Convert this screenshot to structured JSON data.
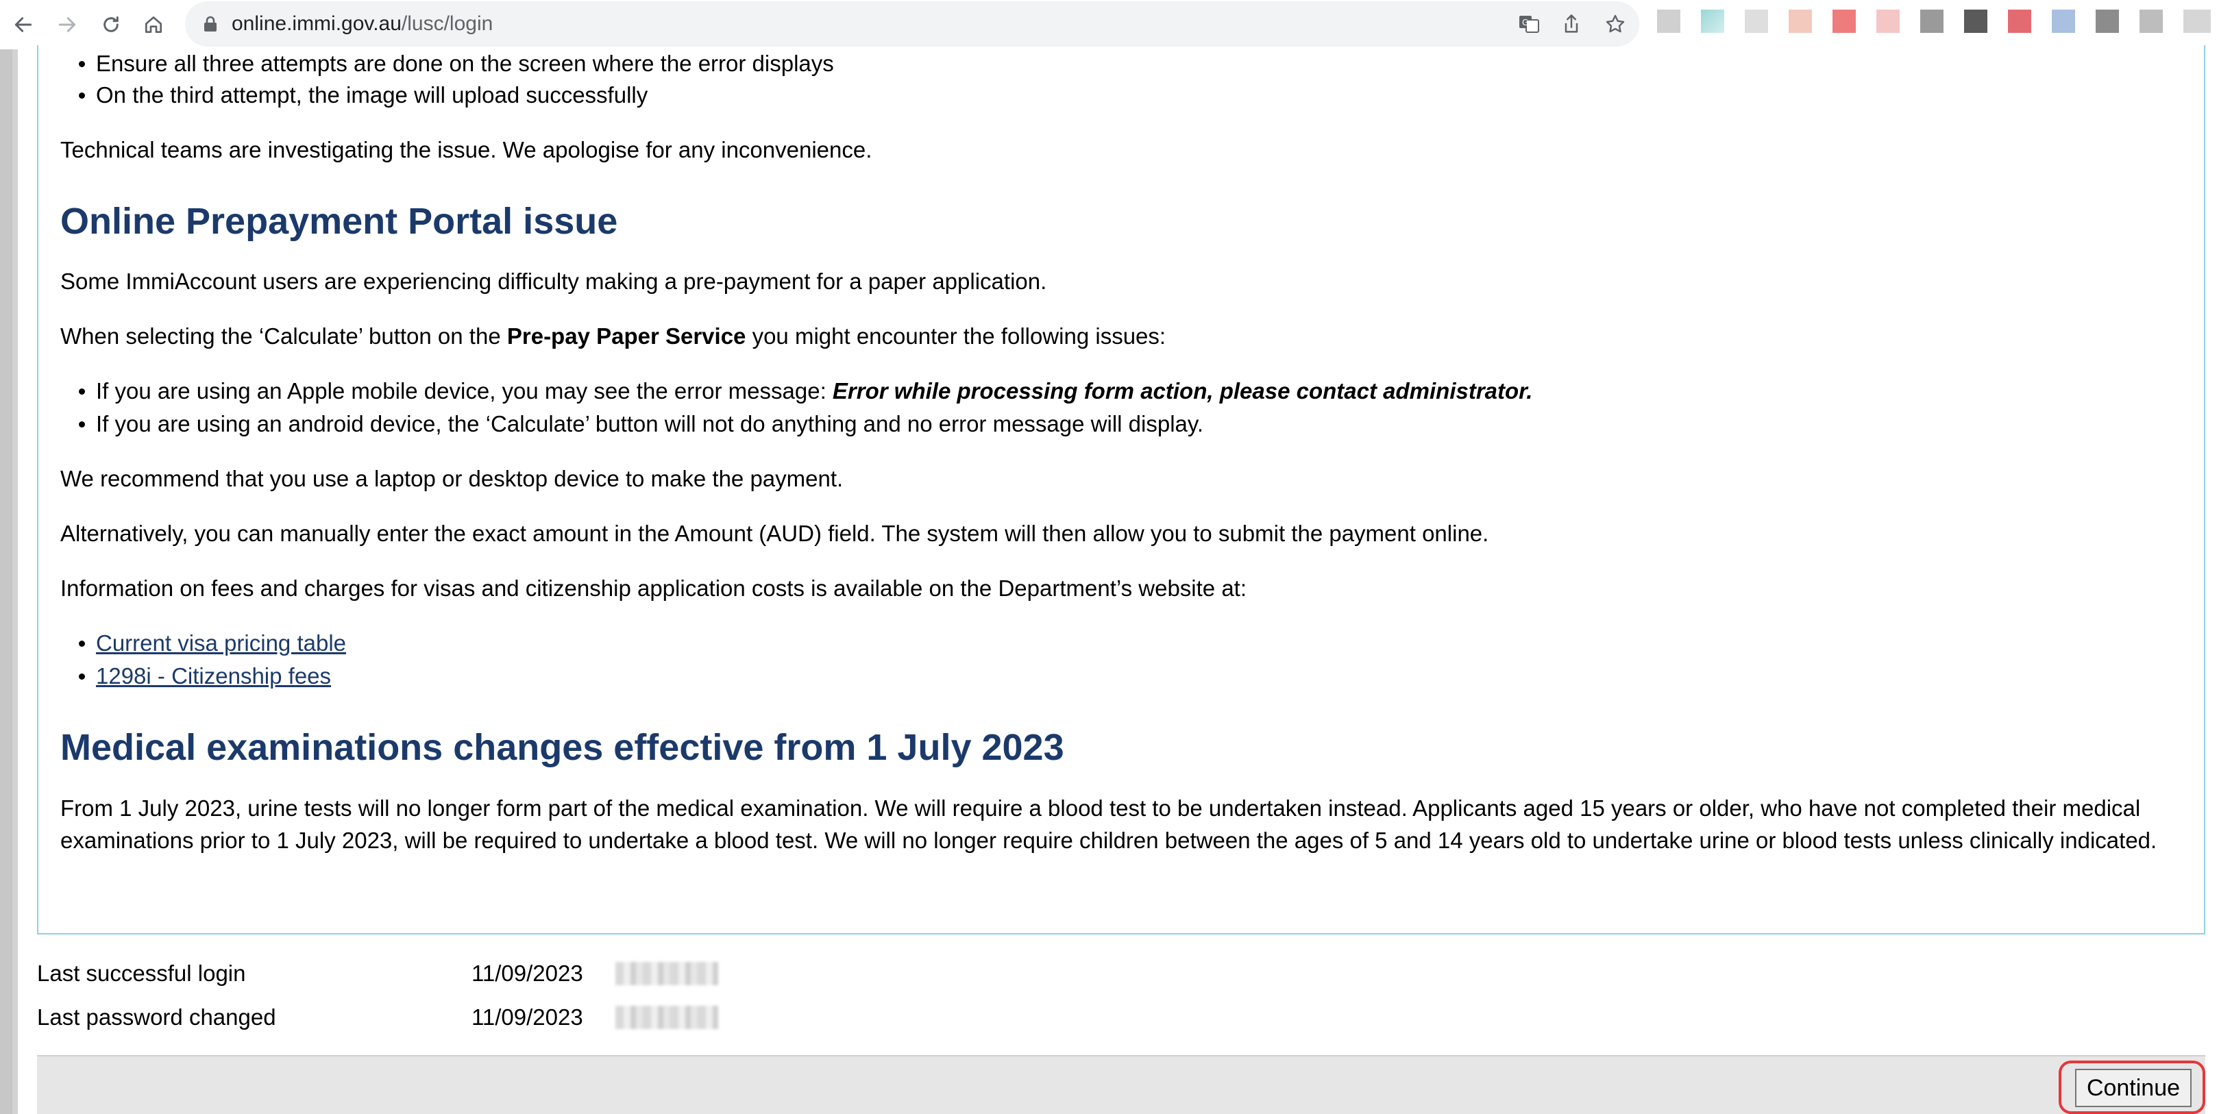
{
  "browser": {
    "url_host": "online.immi.gov.au",
    "url_path": "/lusc/login",
    "icons": [
      "back-arrow-icon",
      "forward-arrow-icon",
      "reload-icon",
      "home-icon",
      "lock-icon",
      "translate-icon",
      "share-icon",
      "star-icon"
    ]
  },
  "notice": {
    "intro_bullets": [
      "Ensure all three attempts are done on the screen where the error displays",
      "On the third attempt, the image will upload successfully"
    ],
    "intro_note": "Technical teams are investigating the issue. We apologise for any inconvenience.",
    "prepay": {
      "heading": "Online Prepayment Portal issue",
      "p1": "Some ImmiAccount users are experiencing difficulty making a pre-payment for a paper application.",
      "p2_before": "When selecting the ‘Calculate’ button on the ",
      "p2_bold": "Pre-pay Paper Service",
      "p2_after": " you might encounter the following issues:",
      "bullet1_before": "If you are using an Apple mobile device, you may see the error message: ",
      "bullet1_emph": "Error while processing form action, please contact administrator.",
      "bullet2": "If you are using an android device, the ‘Calculate’ button will not do anything and no error message will display.",
      "p3": "We recommend that you use a laptop or desktop device to make the payment.",
      "p4": "Alternatively, you can manually enter the exact amount in the Amount (AUD) field. The system will then allow you to submit the payment online.",
      "p5": "Information on fees and charges for visas and citizenship application costs is available on the Department’s website at:",
      "links": [
        "Current visa pricing table",
        "1298i - Citizenship fees"
      ]
    },
    "medical": {
      "heading": "Medical examinations changes effective from 1 July 2023",
      "body": "From 1 July 2023, urine tests will no longer form part of the medical examination. We will require a blood test to be undertaken instead. Applicants aged 15 years or older, who have not completed their medical examinations prior to 1 July 2023, will be required to undertake a blood test. We will no longer require children between the ages of 5 and 14 years old to undertake urine or blood tests unless clinically indicated."
    }
  },
  "login_info": {
    "last_login_label": "Last successful login",
    "last_login_date": "11/09/2023",
    "last_password_label": "Last password changed",
    "last_password_date": "11/09/2023"
  },
  "footer": {
    "continue_label": "Continue"
  },
  "colors": {
    "heading": "#1b3a6b",
    "notice_border": "#8fd0e4",
    "highlight": "#e5373a"
  }
}
